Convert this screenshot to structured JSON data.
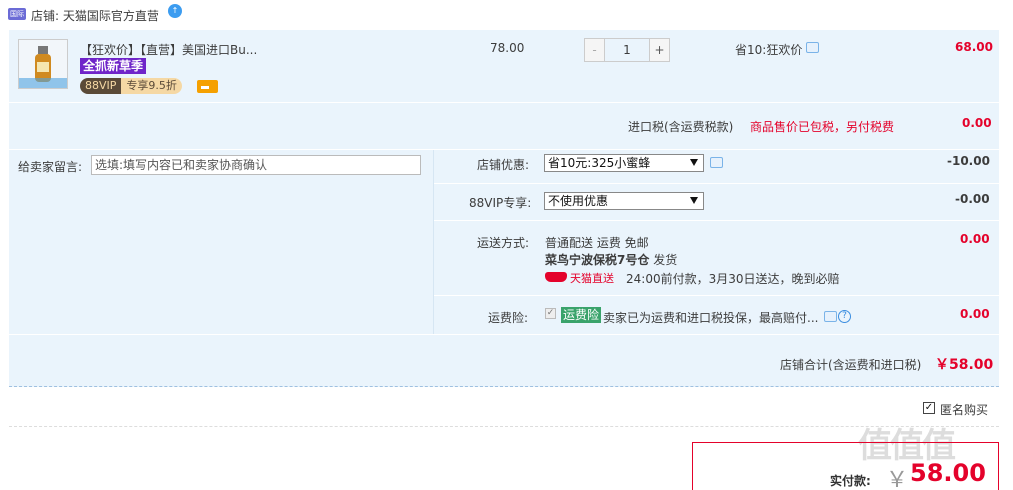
{
  "shop": {
    "name_label": "店铺: 天猫国际官方直营",
    "logo_text": "国际",
    "badge": "↑"
  },
  "item": {
    "title": "【狂欢价】【直营】美国进口Bu...",
    "promo_tag": "全抓新草季",
    "vip_left": "88VIP",
    "vip_right": "专享9.5折",
    "unit_price": "78.00",
    "qty_minus": "-",
    "qty": "1",
    "qty_plus": "+",
    "discount": "省10:狂欢价",
    "total": "68.00"
  },
  "tax": {
    "label": "进口税(含运费税款)",
    "note": "商品售价已包税，另付税费",
    "value": "0.00"
  },
  "message": {
    "label": "给卖家留言:",
    "placeholder": "选填:填写内容已和卖家协商确认"
  },
  "shop_discount": {
    "label": "店铺优惠:",
    "selected": "省10元:325小蜜蜂",
    "value": "-10.00"
  },
  "vip_discount": {
    "label": "88VIP专享:",
    "selected": "不使用优惠",
    "value": "-0.00"
  },
  "shipping": {
    "label": "运送方式:",
    "line1": "普通配送 运费 免邮",
    "warehouse": "菜鸟宁波保税7号仓",
    "ship_from": "发货",
    "tmall_direct": "天猫直送",
    "line3": "24:00前付款，3月30日送达，晚到必赔",
    "value": "0.00"
  },
  "insurance": {
    "label": "运费险:",
    "check": "✓",
    "tag": "运费险",
    "text": "卖家已为运费和进口税投保，最高赔付...",
    "help": "?",
    "value": "0.00"
  },
  "subtotal": {
    "label": "店铺合计(含运费和进口税)",
    "value": "￥58.00"
  },
  "anonymous": {
    "check": "✓",
    "label": "匿名购买"
  },
  "pay": {
    "label": "实付款:",
    "currency": "￥",
    "value": "58.00"
  },
  "watermark": "值值值"
}
